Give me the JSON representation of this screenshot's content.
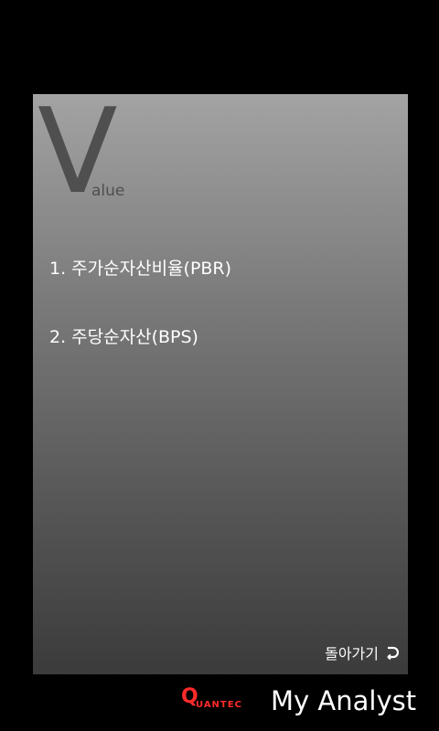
{
  "section": {
    "logo_letter": "V",
    "logo_rest": "alue"
  },
  "menu": {
    "items": [
      {
        "label": "1. 주가순자산비율(PBR)"
      },
      {
        "label": "2. 주당순자산(BPS)"
      }
    ]
  },
  "back": {
    "label": "돌아가기",
    "icon": "return-arrow-icon"
  },
  "branding": {
    "company_q": "Q",
    "company_rest": "UANTEC",
    "app_name": "My Analyst",
    "brand_color": "#ff2a2a"
  }
}
